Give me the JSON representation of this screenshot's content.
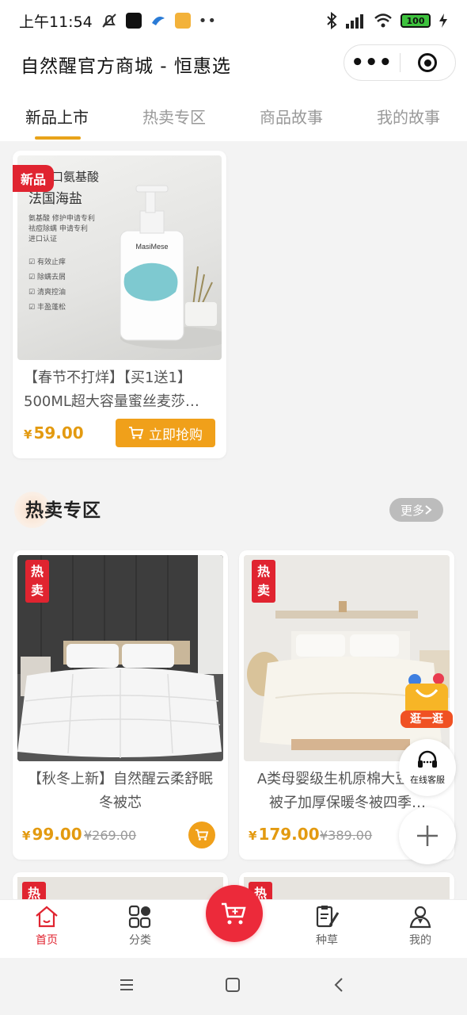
{
  "status": {
    "time": "上午11:54",
    "battery": "100"
  },
  "header": {
    "title": "自然醒官方商城 - 恒惠选",
    "more": "•••"
  },
  "tabs": [
    {
      "label": "新品上市"
    },
    {
      "label": "热卖专区"
    },
    {
      "label": "商品故事"
    },
    {
      "label": "我的故事"
    }
  ],
  "new_products": [
    {
      "badge": "新品",
      "image_text": {
        "line1": "进口氨基酸",
        "line2": "法国海盐",
        "brand": "MasiMese",
        "claims": [
          "氨基酸 修护申请专利",
          "祛痘除螨 申请专利",
          "进口认证"
        ],
        "features": [
          "有效止痒",
          "除螨去屑",
          "清爽控油",
          "丰盈蓬松"
        ]
      },
      "title": "【春节不打烊】【买1送1】500ML超大容量蜜丝麦莎…",
      "currency": "¥",
      "price": "59.00",
      "button": "立即抢购"
    }
  ],
  "hot_section": {
    "title": "热卖专区",
    "more": "更多"
  },
  "hot_products": [
    {
      "badge": [
        "热",
        "卖"
      ],
      "title": "【秋冬上新】自然醒云柔舒眠冬被芯",
      "currency": "¥",
      "price": "99.00",
      "original": "¥269.00"
    },
    {
      "badge": [
        "热",
        "卖"
      ],
      "title": "A类母婴级生机原棉大豆纤维被子加厚保暖冬被四季…",
      "currency": "¥",
      "price": "179.00",
      "original": "¥389.00"
    }
  ],
  "floating": {
    "guang": "逛一逛",
    "service": "在线客服"
  },
  "tabbar": [
    {
      "label": "首页"
    },
    {
      "label": "分类"
    },
    {
      "label": "种草"
    },
    {
      "label": "我的"
    }
  ],
  "colors": {
    "accent": "#f0a01a",
    "red": "#e02430",
    "price": "#e39a10"
  }
}
